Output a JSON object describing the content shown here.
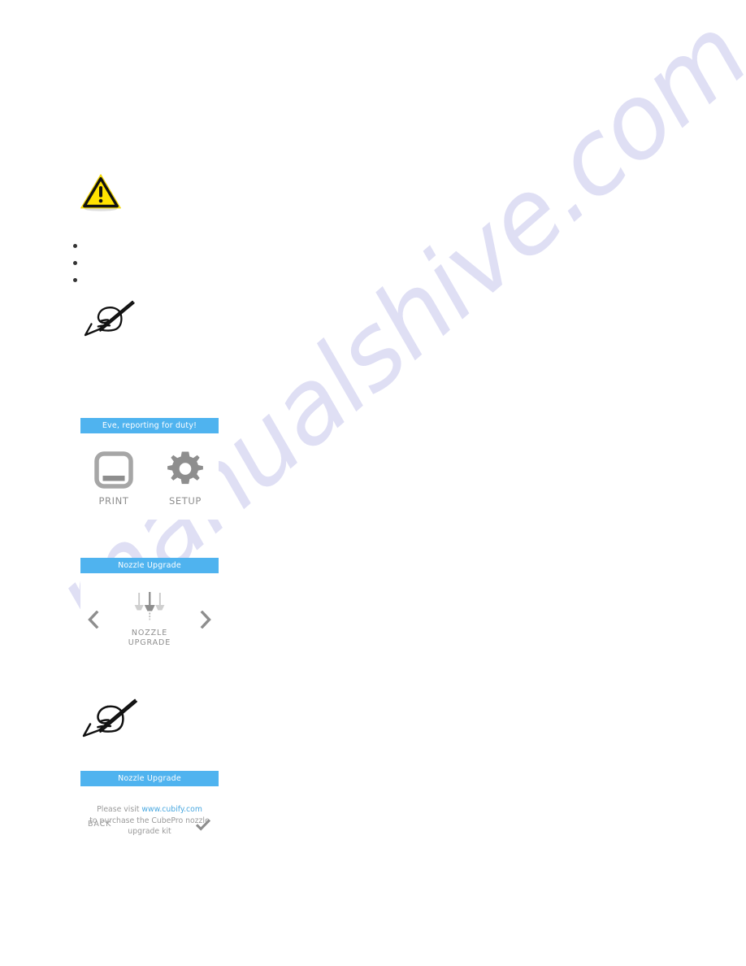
{
  "page": {
    "background_color": "#ffffff",
    "watermark_text": "manualshive.com",
    "watermark_color": "#ccccee"
  },
  "colors": {
    "lcd_header_bg": "#4fb3ef",
    "lcd_header_text": "#ffffff",
    "icon_gray": "#8e8e8e",
    "muted_text": "#9a9a9a",
    "link_blue": "#4aa8e0",
    "warning_yellow": "#ffe200",
    "bullet_black": "#333333"
  },
  "callouts": {
    "warning": {
      "icon": "warning-triangle-icon",
      "text": ""
    },
    "note_top": {
      "icon": "note-pen-icon",
      "text": ""
    },
    "note_bottom": {
      "icon": "note-pen-icon",
      "text": ""
    }
  },
  "bullets": [
    {
      "text": ""
    },
    {
      "text": ""
    },
    {
      "text": ""
    }
  ],
  "panels": {
    "home": {
      "header": "Eve, reporting for duty!",
      "tiles": [
        {
          "icon": "print-icon",
          "label": "PRINT"
        },
        {
          "icon": "gear-icon",
          "label": "SETUP"
        }
      ]
    },
    "nozzle": {
      "header": "Nozzle Upgrade",
      "prev_icon": "chevron-left-icon",
      "next_icon": "chevron-right-icon",
      "item": {
        "icon": "nozzle-upgrade-icon",
        "label_line1": "NOZZLE",
        "label_line2": "UPGRADE"
      }
    },
    "visit": {
      "header": "Nozzle Upgrade",
      "message_prefix": "Please visit ",
      "link_text": "www.cubify.com",
      "message_body": "to purchase the CubePro nozzle upgrade kit",
      "back_label": "BACK",
      "confirm_icon": "checkmark-icon"
    }
  }
}
